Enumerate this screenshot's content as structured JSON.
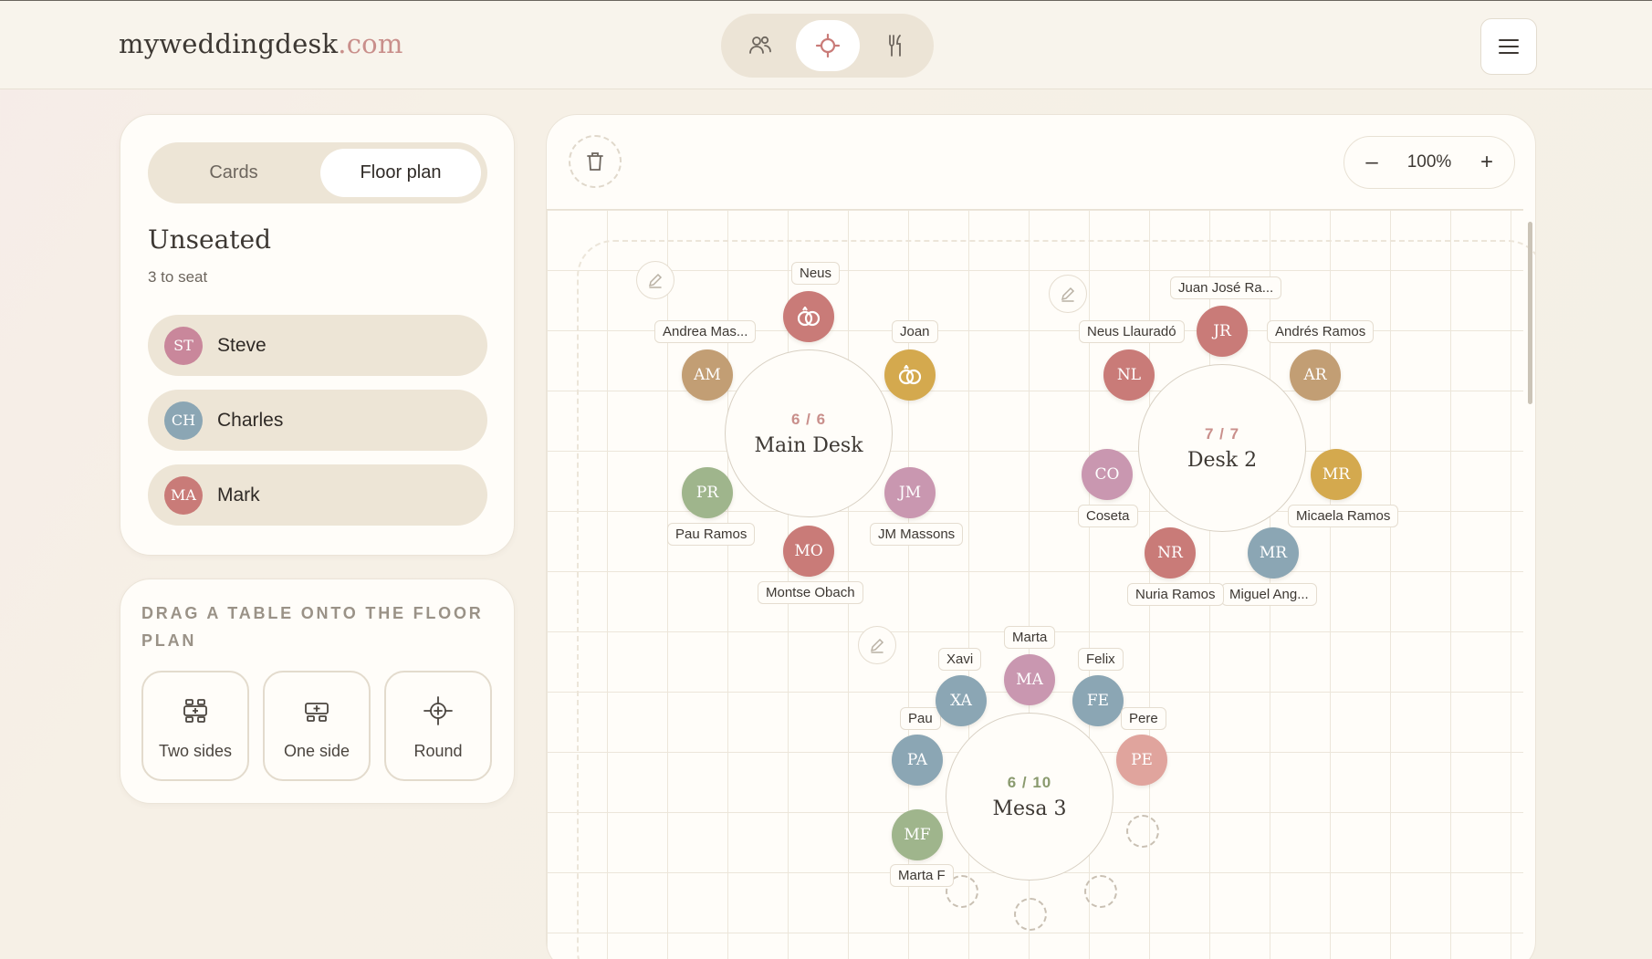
{
  "header": {
    "logo_main": "myweddingdesk",
    "logo_domain": ".com"
  },
  "view_switch": [
    {
      "name": "guests-icon"
    },
    {
      "name": "floor-plan-icon",
      "active": true
    },
    {
      "name": "menu-cutlery-icon"
    }
  ],
  "sidebar": {
    "tabs": {
      "cards": "Cards",
      "floor_plan": "Floor plan"
    },
    "unseated_title": "Unseated",
    "unseated_count": "3 to seat",
    "guests": [
      {
        "initials": "ST",
        "name": "Steve",
        "color": "#c9879b"
      },
      {
        "initials": "CH",
        "name": "Charles",
        "color": "#8ba6b4"
      },
      {
        "initials": "MA",
        "name": "Mark",
        "color": "#c97b78"
      }
    ]
  },
  "drag_panel": {
    "heading": "DRAG A TABLE ONTO THE FLOOR PLAN",
    "buttons": [
      {
        "label": "Two sides",
        "icon": "two-sides-table-icon"
      },
      {
        "label": "One side",
        "icon": "one-side-table-icon"
      },
      {
        "label": "Round",
        "icon": "round-table-icon"
      }
    ]
  },
  "canvas": {
    "zoom_minus": "–",
    "zoom_value": "100%",
    "zoom_plus": "+"
  },
  "tables": [
    {
      "name": "Main Desk",
      "count": "6 / 6",
      "count_color": "#c98f8b",
      "seats": [
        {
          "initials": "",
          "label": "Neus",
          "color": "#c97b78",
          "ring": true
        },
        {
          "initials": "",
          "label": "Joan",
          "color": "#d4a94e",
          "ring": true
        },
        {
          "initials": "JM",
          "label": "JM Massons",
          "color": "#c997b0"
        },
        {
          "initials": "MO",
          "label": "Montse Obach",
          "color": "#c97b78"
        },
        {
          "initials": "PR",
          "label": "Pau Ramos",
          "color": "#9fb58c"
        },
        {
          "initials": "AM",
          "label": "Andrea Mas...",
          "color": "#c29e74"
        }
      ]
    },
    {
      "name": "Desk 2",
      "count": "7 / 7",
      "count_color": "#c98f8b",
      "seats": [
        {
          "initials": "JR",
          "label": "Juan José Ra...",
          "color": "#c97b78"
        },
        {
          "initials": "AR",
          "label": "Andrés Ramos",
          "color": "#c29e74"
        },
        {
          "initials": "MR",
          "label": "Micaela Ramos",
          "color": "#d4a94e"
        },
        {
          "initials": "MR",
          "label": "Miguel Ang...",
          "color": "#8ba6b4"
        },
        {
          "initials": "NR",
          "label": "Nuria Ramos",
          "color": "#c97b78"
        },
        {
          "initials": "CO",
          "label": "Coseta",
          "color": "#c997b0"
        },
        {
          "initials": "NL",
          "label": "Neus Llauradó",
          "color": "#c97b78"
        }
      ]
    },
    {
      "name": "Mesa 3",
      "count": "6 / 10",
      "count_color": "#8a9a6e",
      "seats": [
        {
          "initials": "MA",
          "label": "Marta",
          "color": "#c997b0"
        },
        {
          "initials": "FE",
          "label": "Felix",
          "color": "#8ba6b4"
        },
        {
          "initials": "PE",
          "label": "Pere",
          "color": "#e0a49d"
        },
        {
          "initials": "MF",
          "label": "Marta F",
          "color": "#9fb58c"
        },
        {
          "initials": "PA",
          "label": "Pau",
          "color": "#8ba6b4"
        },
        {
          "initials": "XA",
          "label": "Xavi",
          "color": "#8ba6b4"
        }
      ]
    }
  ]
}
